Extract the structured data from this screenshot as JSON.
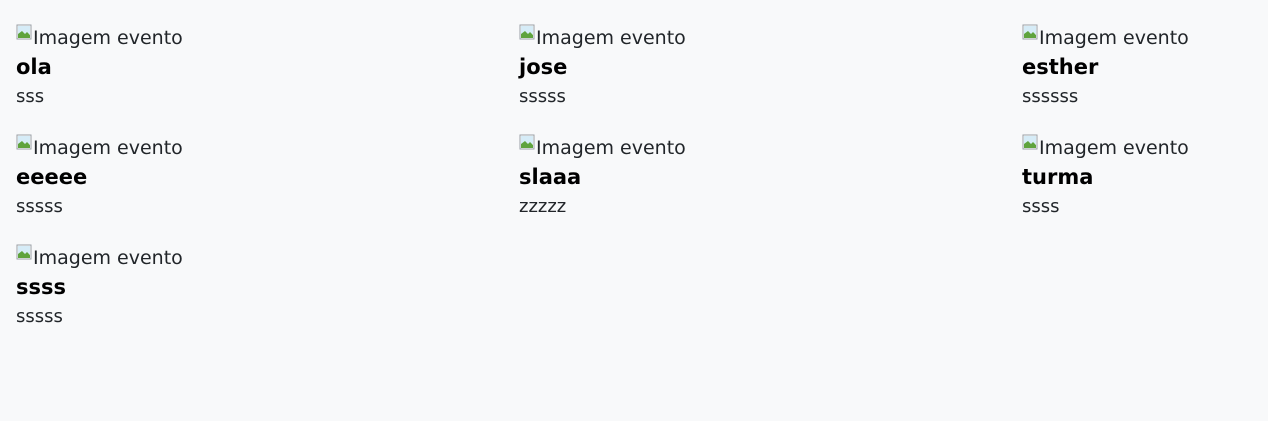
{
  "events": [
    {
      "image_alt": "Imagem evento",
      "title": "ola",
      "description": "sss"
    },
    {
      "image_alt": "Imagem evento",
      "title": "jose",
      "description": "sssss"
    },
    {
      "image_alt": "Imagem evento",
      "title": "esther",
      "description": "ssssss"
    },
    {
      "image_alt": "Imagem evento",
      "title": "eeeee",
      "description": "sssss"
    },
    {
      "image_alt": "Imagem evento",
      "title": "slaaa",
      "description": "zzzzz"
    },
    {
      "image_alt": "Imagem evento",
      "title": "turma",
      "description": "ssss"
    },
    {
      "image_alt": "Imagem evento",
      "title": "ssss",
      "description": "sssss"
    }
  ],
  "icons": {
    "broken_image": "broken-image-icon"
  },
  "colors": {
    "page_background": "#f8f9fa",
    "text": "#212529"
  }
}
